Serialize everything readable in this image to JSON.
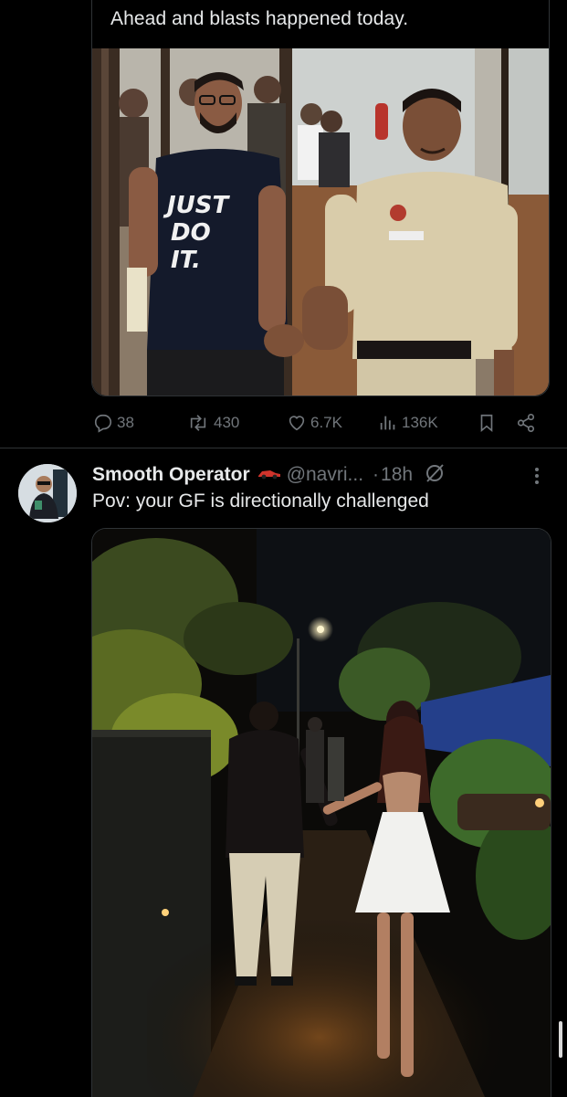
{
  "quoted_tweet": {
    "text_line": "Ahead and blasts happened today.",
    "image_alt": "Man in 'JUST DO IT.' t-shirt walked by hand by police officer",
    "shirt_text": [
      "JUST",
      "DO",
      "IT."
    ]
  },
  "actions": {
    "replies": "38",
    "reposts": "430",
    "likes": "6.7K",
    "views": "136K",
    "reply_icon": "reply-icon",
    "repost_icon": "repost-icon",
    "like_icon": "heart-icon",
    "views_icon": "analytics-icon",
    "bookmark_icon": "bookmark-icon",
    "share_icon": "share-icon"
  },
  "tweet": {
    "display_name": "Smooth Operator",
    "handle": "@navri...",
    "time": "18h",
    "text": "Pov: your GF is directionally challenged",
    "image_alt": "Couple walking hand in hand along a night street lined with plants"
  },
  "colors": {
    "background": "#000000",
    "text": "#e7e9ea",
    "muted": "#71767b",
    "border": "#2f3336"
  }
}
